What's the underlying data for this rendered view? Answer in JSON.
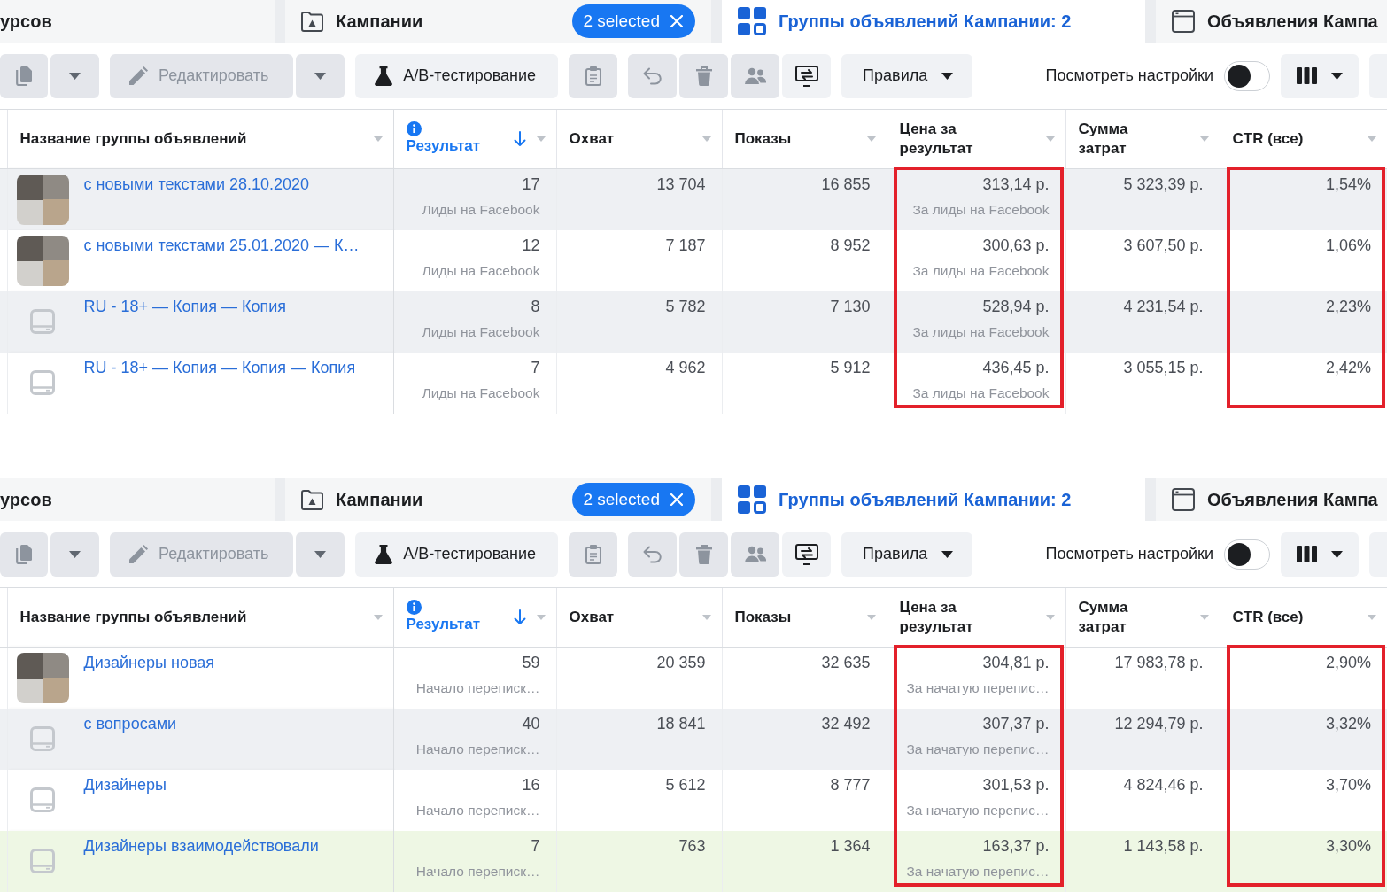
{
  "panels": [
    {
      "tabs": [
        {
          "label": "урсов",
          "kind": "account",
          "selected": false
        },
        {
          "label": "Кампании",
          "kind": "campaigns",
          "selected": false,
          "chip": "2 selected"
        },
        {
          "label": "Группы объявлений Кампании: 2",
          "kind": "adsets",
          "selected": true
        },
        {
          "label": "Объявления Кампа",
          "kind": "ads",
          "selected": false
        }
      ],
      "toolbar": [
        {
          "buttons": [
            {
              "kind": "copy",
              "disabled": true
            },
            {
              "kind": "menu",
              "disabled": true
            }
          ]
        },
        {
          "buttons": [
            {
              "kind": "edit",
              "label": "Редактировать",
              "disabled": true
            },
            {
              "kind": "menu",
              "disabled": true
            }
          ]
        },
        {
          "buttons": [
            {
              "kind": "test",
              "label": "A/B-тестирование",
              "disabled": false
            }
          ]
        },
        {
          "buttons": [
            {
              "kind": "clipboard",
              "disabled": true
            }
          ]
        },
        {
          "buttons": [
            {
              "kind": "undo",
              "disabled": true
            },
            {
              "kind": "delete",
              "disabled": true
            },
            {
              "kind": "audience",
              "disabled": true
            },
            {
              "kind": "swap",
              "disabled": false
            }
          ]
        },
        {
          "buttons": [
            {
              "kind": "rules",
              "label": "Правила",
              "disabled": false
            }
          ]
        }
      ],
      "view_settings": {
        "label": "Посмотреть настройки",
        "on": false
      },
      "toolbar_right": [
        {
          "buttons": [
            {
              "kind": "columns",
              "disabled": false
            }
          ]
        },
        {
          "buttons": [
            {
              "kind": "more",
              "disabled": false
            }
          ]
        }
      ],
      "columns": [
        {
          "label": "Название группы объявлений",
          "kind": "name",
          "sorted": false,
          "outlined": false
        },
        {
          "label": "Результат",
          "kind": "result",
          "sorted": true,
          "outlined": false
        },
        {
          "label": "Охват",
          "kind": "metric",
          "sorted": false,
          "outlined": false
        },
        {
          "label": "Показы",
          "kind": "metric",
          "sorted": false,
          "outlined": false
        },
        {
          "label": "Цена за результат",
          "kind": "metric",
          "sorted": false,
          "outlined": true
        },
        {
          "label": "Сумма затрат",
          "kind": "metric",
          "sorted": false,
          "outlined": false
        },
        {
          "label": "CTR (все)",
          "kind": "metric",
          "sorted": false,
          "outlined": true
        }
      ],
      "rows": [
        {
          "kind": "photo",
          "shaded": true,
          "highlighted": false,
          "cells": [
            {
              "value": "с новыми текстами 28.10.2020"
            },
            {
              "value": "17",
              "note": "Лиды на Facebook"
            },
            {
              "value": "13 704"
            },
            {
              "value": "16 855"
            },
            {
              "value": "313,14 р.",
              "note": "За лиды на Facebook"
            },
            {
              "value": "5 323,39 р."
            },
            {
              "value": "1,54%"
            }
          ]
        },
        {
          "kind": "photo",
          "shaded": false,
          "highlighted": false,
          "cells": [
            {
              "value": "с новыми текстами 25.01.2020 — К…"
            },
            {
              "value": "12",
              "note": "Лиды на Facebook"
            },
            {
              "value": "7 187"
            },
            {
              "value": "8 952"
            },
            {
              "value": "300,63 р.",
              "note": "За лиды на Facebook"
            },
            {
              "value": "3 607,50 р."
            },
            {
              "value": "1,06%"
            }
          ]
        },
        {
          "kind": "placeholder",
          "shaded": true,
          "highlighted": false,
          "cells": [
            {
              "value": "RU - 18+ — Копия — Копия"
            },
            {
              "value": "8",
              "note": "Лиды на Facebook"
            },
            {
              "value": "5 782"
            },
            {
              "value": "7 130"
            },
            {
              "value": "528,94 р.",
              "note": "За лиды на Facebook"
            },
            {
              "value": "4 231,54 р."
            },
            {
              "value": "2,23%"
            }
          ]
        },
        {
          "kind": "placeholder",
          "shaded": false,
          "highlighted": false,
          "cells": [
            {
              "value": "RU - 18+ — Копия — Копия — Копия"
            },
            {
              "value": "7",
              "note": "Лиды на Facebook"
            },
            {
              "value": "4 962"
            },
            {
              "value": "5 912"
            },
            {
              "value": "436,45 р.",
              "note": "За лиды на Facebook"
            },
            {
              "value": "3 055,15 р."
            },
            {
              "value": "2,42%"
            }
          ]
        }
      ]
    },
    {
      "tabs": [
        {
          "label": "урсов",
          "kind": "account",
          "selected": false
        },
        {
          "label": "Кампании",
          "kind": "campaigns",
          "selected": false,
          "chip": "2 selected"
        },
        {
          "label": "Группы объявлений Кампании: 2",
          "kind": "adsets",
          "selected": true
        },
        {
          "label": "Объявления Кампа",
          "kind": "ads",
          "selected": false
        }
      ],
      "toolbar": [
        {
          "buttons": [
            {
              "kind": "copy",
              "disabled": true
            },
            {
              "kind": "menu",
              "disabled": true
            }
          ]
        },
        {
          "buttons": [
            {
              "kind": "edit",
              "label": "Редактировать",
              "disabled": true
            },
            {
              "kind": "menu",
              "disabled": true
            }
          ]
        },
        {
          "buttons": [
            {
              "kind": "test",
              "label": "A/B-тестирование",
              "disabled": false
            }
          ]
        },
        {
          "buttons": [
            {
              "kind": "clipboard",
              "disabled": true
            }
          ]
        },
        {
          "buttons": [
            {
              "kind": "undo",
              "disabled": true
            },
            {
              "kind": "delete",
              "disabled": true
            },
            {
              "kind": "audience",
              "disabled": true
            },
            {
              "kind": "swap",
              "disabled": false
            }
          ]
        },
        {
          "buttons": [
            {
              "kind": "rules",
              "label": "Правила",
              "disabled": false
            }
          ]
        }
      ],
      "view_settings": {
        "label": "Посмотреть настройки",
        "on": false
      },
      "toolbar_right": [
        {
          "buttons": [
            {
              "kind": "columns",
              "disabled": false
            }
          ]
        },
        {
          "buttons": [
            {
              "kind": "more",
              "disabled": false
            }
          ]
        }
      ],
      "columns": [
        {
          "label": "Название группы объявлений",
          "kind": "name",
          "sorted": false,
          "outlined": false
        },
        {
          "label": "Результат",
          "kind": "result",
          "sorted": true,
          "outlined": false
        },
        {
          "label": "Охват",
          "kind": "metric",
          "sorted": false,
          "outlined": false
        },
        {
          "label": "Показы",
          "kind": "metric",
          "sorted": false,
          "outlined": false
        },
        {
          "label": "Цена за результат",
          "kind": "metric",
          "sorted": false,
          "outlined": true
        },
        {
          "label": "Сумма затрат",
          "kind": "metric",
          "sorted": false,
          "outlined": false
        },
        {
          "label": "CTR (все)",
          "kind": "metric",
          "sorted": false,
          "outlined": true
        }
      ],
      "rows": [
        {
          "kind": "photo",
          "shaded": false,
          "highlighted": false,
          "cells": [
            {
              "value": "Дизайнеры новая"
            },
            {
              "value": "59",
              "note": "Начало переписк…"
            },
            {
              "value": "20 359"
            },
            {
              "value": "32 635"
            },
            {
              "value": "304,81 р.",
              "note": "За начатую перепис…"
            },
            {
              "value": "17 983,78 р."
            },
            {
              "value": "2,90%"
            }
          ]
        },
        {
          "kind": "placeholder",
          "shaded": true,
          "highlighted": false,
          "cells": [
            {
              "value": "с вопросами"
            },
            {
              "value": "40",
              "note": "Начало переписк…"
            },
            {
              "value": "18 841"
            },
            {
              "value": "32 492"
            },
            {
              "value": "307,37 р.",
              "note": "За начатую перепис…"
            },
            {
              "value": "12 294,79 р."
            },
            {
              "value": "3,32%"
            }
          ]
        },
        {
          "kind": "placeholder",
          "shaded": false,
          "highlighted": false,
          "cells": [
            {
              "value": "Дизайнеры"
            },
            {
              "value": "16",
              "note": "Начало переписк…"
            },
            {
              "value": "5 612"
            },
            {
              "value": "8 777"
            },
            {
              "value": "301,53 р.",
              "note": "За начатую перепис…"
            },
            {
              "value": "4 824,46 р."
            },
            {
              "value": "3,70%"
            }
          ]
        },
        {
          "kind": "placeholder",
          "shaded": false,
          "highlighted": true,
          "cells": [
            {
              "value": "Дизайнеры взаимодействовали"
            },
            {
              "value": "7",
              "note": "Начало переписк…"
            },
            {
              "value": "763"
            },
            {
              "value": "1 364"
            },
            {
              "value": "163,37 р.",
              "note": "За начатую перепис…"
            },
            {
              "value": "1 143,58 р."
            },
            {
              "value": "3,30%"
            }
          ]
        }
      ]
    }
  ]
}
